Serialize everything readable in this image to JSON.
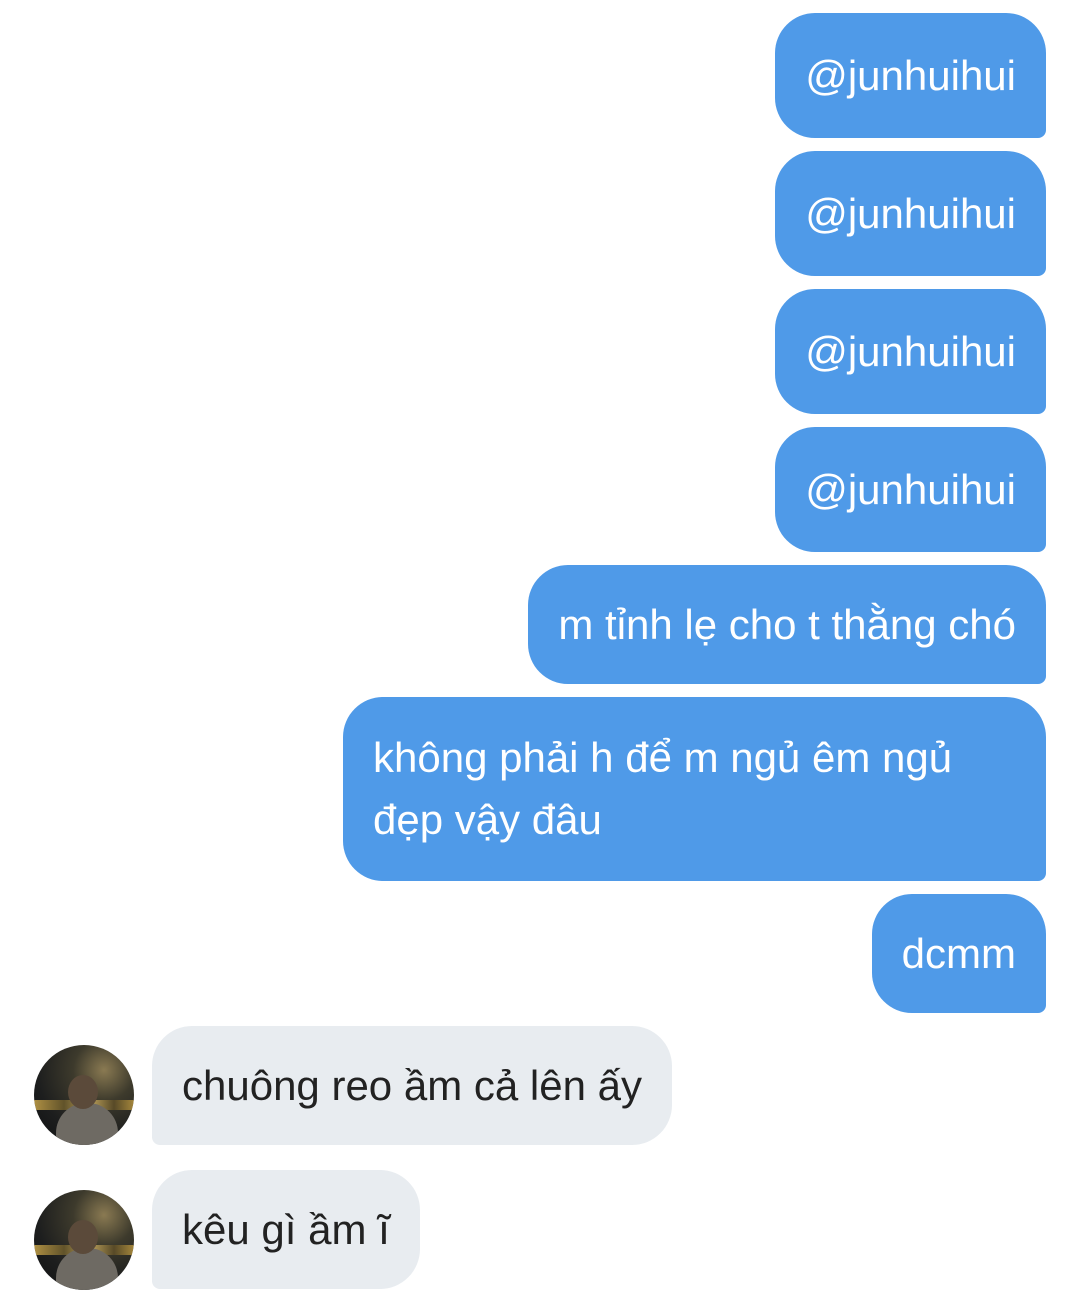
{
  "conversation": {
    "sent_messages": [
      "@junhuihui",
      "@junhuihui",
      "@junhuihui",
      "@junhuihui",
      "m tỉnh lẹ cho t thằng chó",
      "không phải h để m ngủ êm ngủ đẹp vậy đâu",
      "dcmm"
    ],
    "received_messages": [
      "chuông reo ầm cả lên ấy",
      "kêu gì ầm ĩ"
    ]
  },
  "colors": {
    "sent_bubble": "#4f9ae8",
    "received_bubble": "#e8ecf0",
    "sent_text": "#ffffff",
    "received_text": "#222222"
  }
}
